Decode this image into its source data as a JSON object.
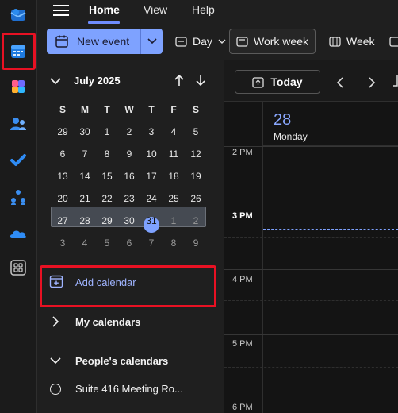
{
  "rail": {
    "items": [
      {
        "name": "mail-icon",
        "color": "#3a8ee6"
      },
      {
        "name": "calendar-icon",
        "color": "#3a8ee6"
      },
      {
        "name": "copilot-icon",
        "color": "#c55aff"
      },
      {
        "name": "people-icon",
        "color": "#4a90e2"
      },
      {
        "name": "todo-icon",
        "color": "#3a8ee6"
      },
      {
        "name": "org-explorer-icon",
        "color": "#3a8ee6"
      },
      {
        "name": "onedrive-icon",
        "color": "#3a8ee6"
      },
      {
        "name": "apps-icon",
        "color": "#bdbdbd"
      }
    ]
  },
  "topbar": {
    "tabs": [
      {
        "label": "Home",
        "active": true
      },
      {
        "label": "View",
        "active": false
      },
      {
        "label": "Help",
        "active": false
      }
    ]
  },
  "ribbon": {
    "new_event_label": "New event",
    "day_label": "Day",
    "work_week_label": "Work week",
    "week_label": "Week"
  },
  "mini_calendar": {
    "month_label": "July 2025",
    "weekdays": [
      "S",
      "M",
      "T",
      "W",
      "T",
      "F",
      "S"
    ],
    "weeks": [
      [
        "29",
        "30",
        "1",
        "2",
        "3",
        "4",
        "5"
      ],
      [
        "6",
        "7",
        "8",
        "9",
        "10",
        "11",
        "12"
      ],
      [
        "13",
        "14",
        "15",
        "16",
        "17",
        "18",
        "19"
      ],
      [
        "20",
        "21",
        "22",
        "23",
        "24",
        "25",
        "26"
      ],
      [
        "27",
        "28",
        "29",
        "30",
        "31",
        "1",
        "2"
      ],
      [
        "3",
        "4",
        "5",
        "6",
        "7",
        "8",
        "9"
      ]
    ],
    "today": "31"
  },
  "left_pane": {
    "add_calendar_label": "Add calendar",
    "my_calendars_label": "My calendars",
    "peoples_calendars_label": "People's calendars",
    "people": [
      "Suite 416 Meeting Ro..."
    ]
  },
  "calendar": {
    "today_label": "Today",
    "day_number": "28",
    "day_name": "Monday",
    "hours": [
      "2 PM",
      "3 PM",
      "4 PM",
      "5 PM",
      "6 PM"
    ],
    "accent": "#7ea2ff"
  }
}
